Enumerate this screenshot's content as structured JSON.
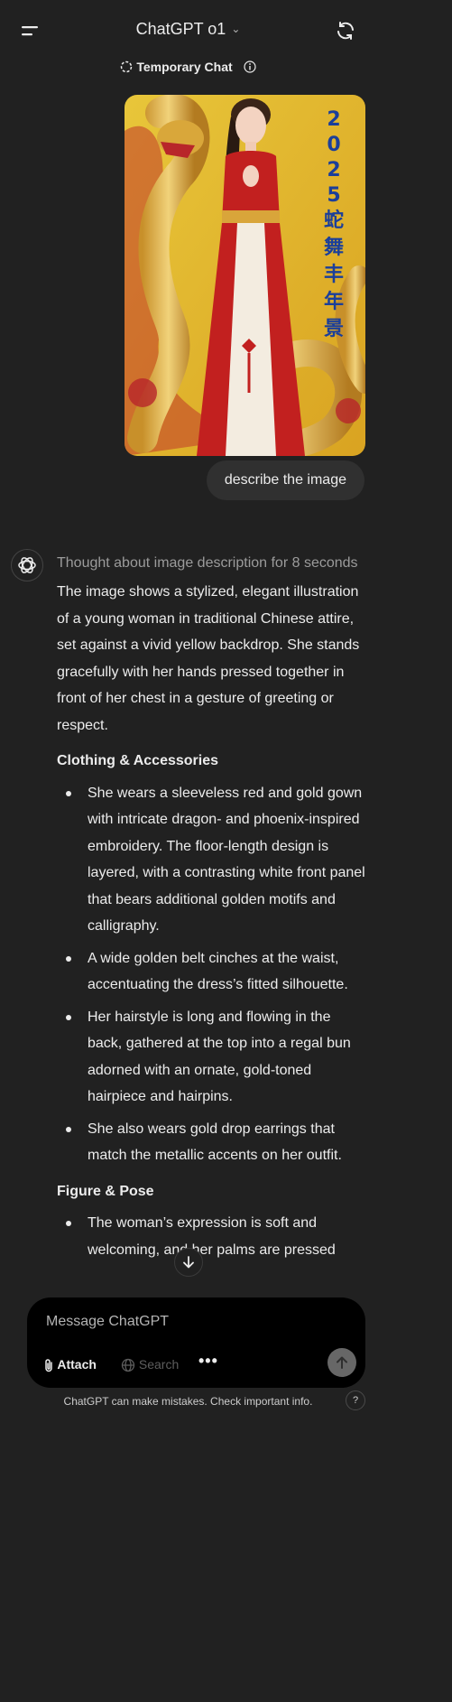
{
  "header": {
    "model_name": "ChatGPT o1",
    "temporary_chat_label": "Temporary Chat"
  },
  "user_message": {
    "text": "describe the image",
    "image_text": "2025蛇舞丰年景"
  },
  "assistant": {
    "thought": "Thought about image description for 8 seconds",
    "intro": "The image shows a stylized, elegant illustration of a young woman in traditional Chinese attire, set against a vivid yellow backdrop. She stands gracefully with her hands pressed together in front of her chest in a gesture of greeting or respect.",
    "section1_title": "Clothing & Accessories",
    "section1_bullets": [
      "She wears a sleeveless red and gold gown with intricate dragon- and phoenix-inspired embroidery. The floor-length design is layered, with a contrasting white front panel that bears additional golden motifs and calligraphy.",
      "A wide golden belt cinches at the waist, accentuating the dress’s fitted silhouette.",
      "Her hairstyle is long and flowing in the back, gathered at the top into a regal bun adorned with an ornate, gold-toned hairpiece and hairpins.",
      "She also wears gold drop earrings that match the metallic accents on her outfit."
    ],
    "section2_title": "Figure & Pose",
    "section2_bullets": [
      "The woman’s expression is soft and welcoming, and her palms are pressed"
    ]
  },
  "composer": {
    "placeholder": "Message ChatGPT",
    "attach_label": "Attach",
    "search_label": "Search",
    "more_label": "•••"
  },
  "footer": {
    "disclaimer": "ChatGPT can make mistakes. Check important info.",
    "help_label": "?"
  },
  "icons": {
    "menu": "menu-icon",
    "chevron": "chevron-down-icon",
    "refresh": "refresh-icon",
    "temporary": "dashed-circle-icon",
    "info": "info-icon",
    "assistant": "openai-logo-icon",
    "scroll_down": "arrow-down-icon",
    "attach": "paperclip-icon",
    "search": "globe-icon",
    "send": "arrow-up-icon"
  },
  "colors": {
    "background": "#212121",
    "bubble": "#303030",
    "composer": "#000000",
    "muted_text": "#9b9b9b"
  }
}
